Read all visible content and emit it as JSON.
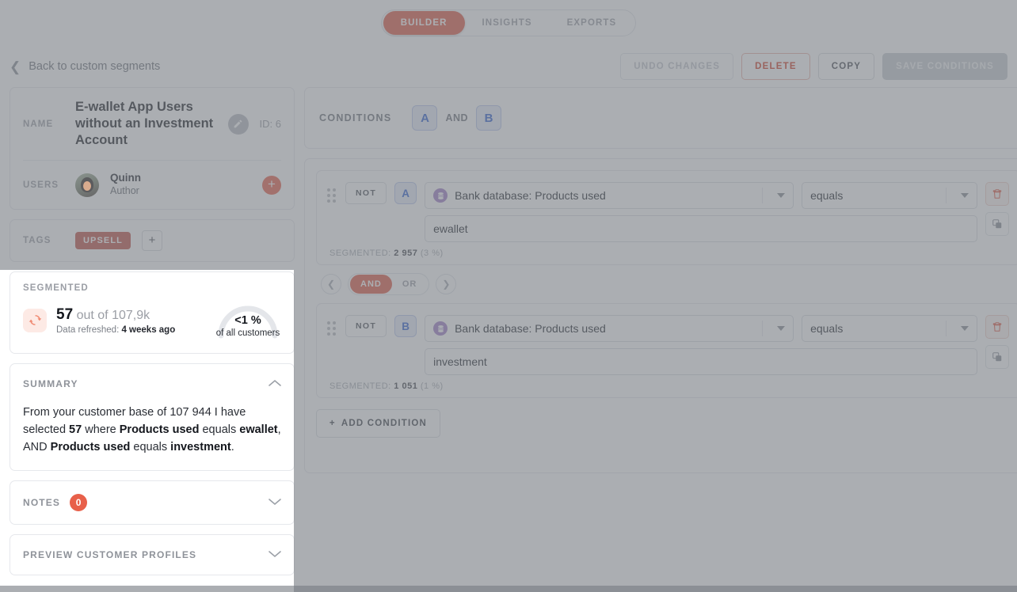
{
  "topbar": {
    "tabs": [
      {
        "label": "BUILDER",
        "active": true
      },
      {
        "label": "INSIGHTS",
        "active": false
      },
      {
        "label": "EXPORTS",
        "active": false
      }
    ]
  },
  "header": {
    "back_label": "Back to custom segments",
    "back_icon": "chevron-left-icon",
    "buttons": {
      "undo": "UNDO CHANGES",
      "delete": "DELETE",
      "copy": "COPY",
      "save": "SAVE CONDITIONS"
    }
  },
  "sidebar": {
    "name_card": {
      "label": "NAME",
      "value": "E-wallet App Users without an Investment Account",
      "edit_icon": "pencil-icon",
      "id_text": "ID: 6"
    },
    "users_card": {
      "label": "USERS",
      "user_name": "Quinn",
      "user_role": "Author",
      "add_icon": "plus-icon"
    },
    "tags_card": {
      "label": "TAGS",
      "tags": [
        "UPSELL"
      ],
      "add_icon": "plus-icon"
    },
    "segmented_card": {
      "title": "SEGMENTED",
      "refresh_icon": "refresh-icon",
      "count": "57",
      "out_of": "out of 107,9k",
      "refreshed_prefix": "Data refreshed:",
      "refreshed_value": "4 weeks ago",
      "gauge_percent": "<1 %",
      "gauge_label": "of all customers"
    },
    "summary_card": {
      "title": "SUMMARY",
      "chevron": "chevron-up-icon",
      "text_parts": [
        {
          "t": "From your customer base of 107 944 I have selected ",
          "b": false
        },
        {
          "t": "57",
          "b": true
        },
        {
          "t": " where ",
          "b": false
        },
        {
          "t": "Products used",
          "b": true
        },
        {
          "t": " equals ",
          "b": false
        },
        {
          "t": "ewallet",
          "b": true
        },
        {
          "t": ", AND ",
          "b": false
        },
        {
          "t": "Products used",
          "b": true
        },
        {
          "t": " equals ",
          "b": false
        },
        {
          "t": "investment",
          "b": true
        },
        {
          "t": ".",
          "b": false
        }
      ]
    },
    "notes_card": {
      "title": "NOTES",
      "count": "0",
      "chevron": "chevron-down-icon"
    },
    "preview_card": {
      "title": "PREVIEW CUSTOMER PROFILES",
      "chevron": "chevron-down-icon"
    }
  },
  "conditions": {
    "header_label": "CONDITIONS",
    "badges": [
      "A",
      "B"
    ],
    "joiner": "AND",
    "rows": [
      {
        "badge": "A",
        "not_label": "NOT",
        "attribute_icon": "database-icon",
        "attribute": "Bank database: Products used",
        "operator": "equals",
        "value": "ewallet",
        "segmented_label": "SEGMENTED:",
        "segmented_count": "2 957",
        "segmented_percent": "(3 %)",
        "delete_icon": "trash-icon",
        "duplicate_icon": "copy-icon"
      },
      {
        "badge": "B",
        "not_label": "NOT",
        "attribute_icon": "database-icon",
        "attribute": "Bank database: Products used",
        "operator": "equals",
        "value": "investment",
        "segmented_label": "SEGMENTED:",
        "segmented_count": "1 051",
        "segmented_percent": "(1 %)",
        "delete_icon": "trash-icon",
        "duplicate_icon": "copy-icon"
      }
    ],
    "connector": {
      "prev_icon": "chevron-left-icon",
      "next_icon": "chevron-right-icon",
      "options": [
        {
          "label": "AND",
          "selected": true
        },
        {
          "label": "OR",
          "selected": false
        }
      ]
    },
    "add_condition": "ADD CONDITION",
    "add_icon": "plus-icon"
  },
  "colors": {
    "accent": "#e05b46",
    "danger": "#cf3c22",
    "badge_blue": "#2f5fd0",
    "tag_red": "#bf5248",
    "db_purple": "#a07ec8"
  }
}
